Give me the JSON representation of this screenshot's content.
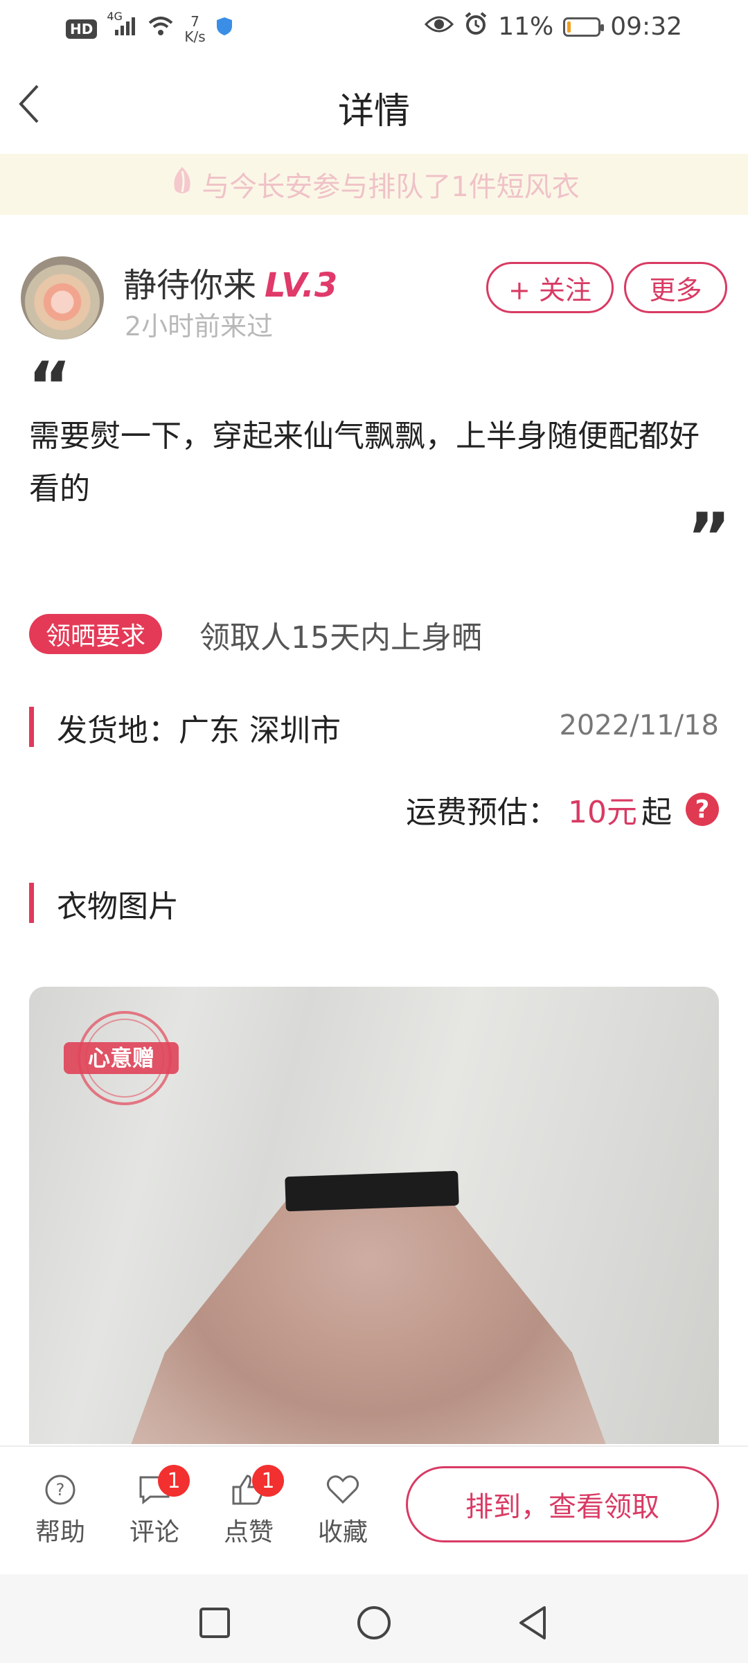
{
  "status_bar": {
    "hd": "HD",
    "network": "4G",
    "net_speed_value": "7",
    "net_speed_unit": "K/s",
    "battery_pct": "11%",
    "battery_level": 0.11,
    "time": "09:32"
  },
  "header": {
    "title": "详情"
  },
  "banner": {
    "text": "与今长安参与排队了1件短风衣"
  },
  "user": {
    "name": "静待你来",
    "level": "LV.3",
    "last_seen": "2小时前来过",
    "follow_label": "+ 关注",
    "more_label": "更多"
  },
  "review": {
    "text": "需要熨一下，穿起来仙气飘飘，上半身随便配都好看的"
  },
  "requirement": {
    "tag": "领晒要求",
    "text": "领取人15天内上身晒"
  },
  "shipping": {
    "label": "发货地：广东 深圳市",
    "date": "2022/11/18",
    "fee_label": "运费预估：",
    "fee_value": "10元",
    "fee_suffix": "起"
  },
  "photos": {
    "title": "衣物图片",
    "stamp_text": "心意赠"
  },
  "bottom_bar": {
    "help": "帮助",
    "comment": "评论",
    "comment_count": "1",
    "like": "点赞",
    "like_count": "1",
    "favorite": "收藏",
    "claim_button": "排到，查看领取"
  },
  "colors": {
    "accent": "#d83a63",
    "banner_bg": "#fbf7e6",
    "tag_bg": "#e43a57"
  }
}
